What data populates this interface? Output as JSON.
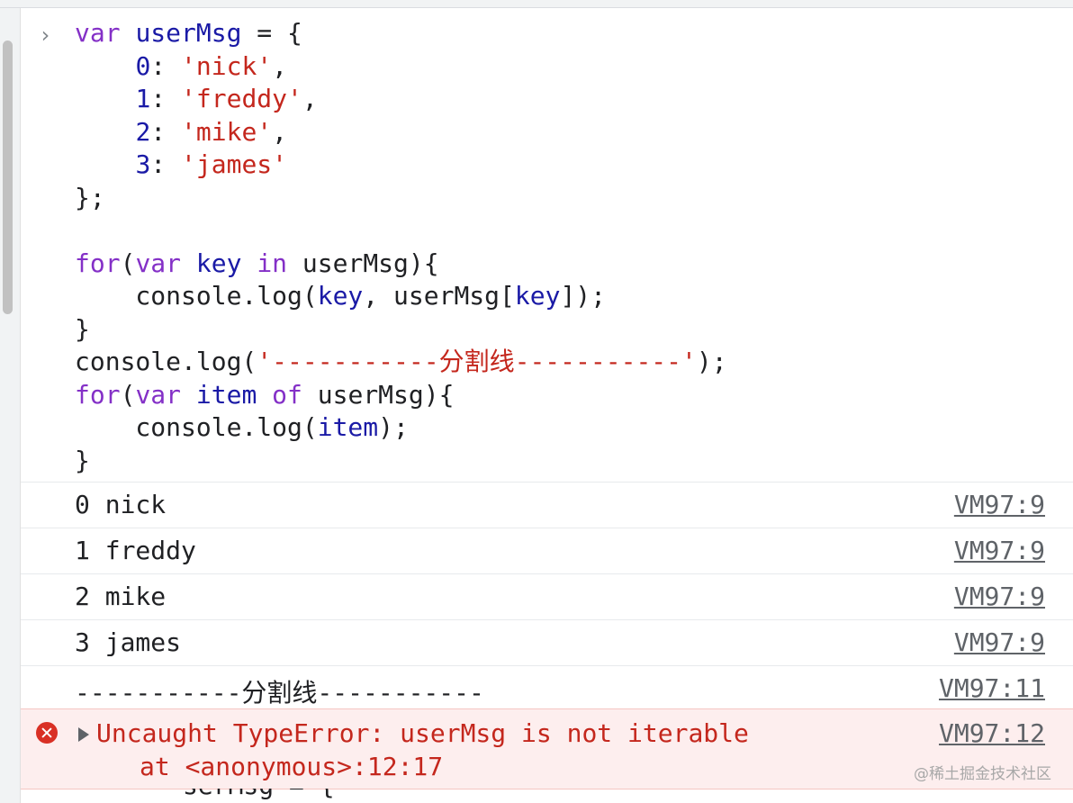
{
  "console": {
    "prompt_glyph": "›",
    "input_code": [
      [
        {
          "t": "kw",
          "v": "var"
        },
        {
          "t": "pl",
          "v": " "
        },
        {
          "t": "id",
          "v": "userMsg"
        },
        {
          "t": "pl",
          "v": " = {"
        }
      ],
      [
        {
          "t": "pl",
          "v": "    "
        },
        {
          "t": "id",
          "v": "0"
        },
        {
          "t": "pl",
          "v": ": "
        },
        {
          "t": "str",
          "v": "'nick'"
        },
        {
          "t": "pl",
          "v": ","
        }
      ],
      [
        {
          "t": "pl",
          "v": "    "
        },
        {
          "t": "id",
          "v": "1"
        },
        {
          "t": "pl",
          "v": ": "
        },
        {
          "t": "str",
          "v": "'freddy'"
        },
        {
          "t": "pl",
          "v": ","
        }
      ],
      [
        {
          "t": "pl",
          "v": "    "
        },
        {
          "t": "id",
          "v": "2"
        },
        {
          "t": "pl",
          "v": ": "
        },
        {
          "t": "str",
          "v": "'mike'"
        },
        {
          "t": "pl",
          "v": ","
        }
      ],
      [
        {
          "t": "pl",
          "v": "    "
        },
        {
          "t": "id",
          "v": "3"
        },
        {
          "t": "pl",
          "v": ": "
        },
        {
          "t": "str",
          "v": "'james'"
        }
      ],
      [
        {
          "t": "pl",
          "v": "};"
        }
      ],
      [
        {
          "t": "pl",
          "v": ""
        }
      ],
      [
        {
          "t": "kw",
          "v": "for"
        },
        {
          "t": "pl",
          "v": "("
        },
        {
          "t": "kw",
          "v": "var"
        },
        {
          "t": "pl",
          "v": " "
        },
        {
          "t": "id",
          "v": "key"
        },
        {
          "t": "pl",
          "v": " "
        },
        {
          "t": "kw",
          "v": "in"
        },
        {
          "t": "pl",
          "v": " userMsg){"
        }
      ],
      [
        {
          "t": "pl",
          "v": "    console.log("
        },
        {
          "t": "id",
          "v": "key"
        },
        {
          "t": "pl",
          "v": ", userMsg["
        },
        {
          "t": "id",
          "v": "key"
        },
        {
          "t": "pl",
          "v": "]);"
        }
      ],
      [
        {
          "t": "pl",
          "v": "}"
        }
      ],
      [
        {
          "t": "pl",
          "v": "console.log("
        },
        {
          "t": "str",
          "v": "'-----------分割线-----------'"
        },
        {
          "t": "pl",
          "v": ");"
        }
      ],
      [
        {
          "t": "kw",
          "v": "for"
        },
        {
          "t": "pl",
          "v": "("
        },
        {
          "t": "kw",
          "v": "var"
        },
        {
          "t": "pl",
          "v": " "
        },
        {
          "t": "id",
          "v": "item"
        },
        {
          "t": "pl",
          "v": " "
        },
        {
          "t": "kw",
          "v": "of"
        },
        {
          "t": "pl",
          "v": " userMsg){"
        }
      ],
      [
        {
          "t": "pl",
          "v": "    console.log("
        },
        {
          "t": "id",
          "v": "item"
        },
        {
          "t": "pl",
          "v": ");"
        }
      ],
      [
        {
          "t": "pl",
          "v": "}"
        }
      ]
    ],
    "log_rows": [
      {
        "text": "0 nick",
        "source": "VM97:9"
      },
      {
        "text": "1 freddy",
        "source": "VM97:9"
      },
      {
        "text": "2 mike",
        "source": "VM97:9"
      },
      {
        "text": "3 james",
        "source": "VM97:9"
      },
      {
        "text": "-----------分割线-----------",
        "source": "VM97:11"
      }
    ],
    "error": {
      "message": "Uncaught TypeError: userMsg is not iterable",
      "stack": "at <anonymous>:12:17",
      "source": "VM97:12"
    },
    "partial_next_line": "serMsg = {"
  },
  "watermark": "@稀土掘金技术社区",
  "colors": {
    "keyword": "#8430c7",
    "identifier": "#1a1aa6",
    "string": "#c4271d",
    "error_bg": "#fdeeee",
    "error_icon": "#d93025"
  }
}
